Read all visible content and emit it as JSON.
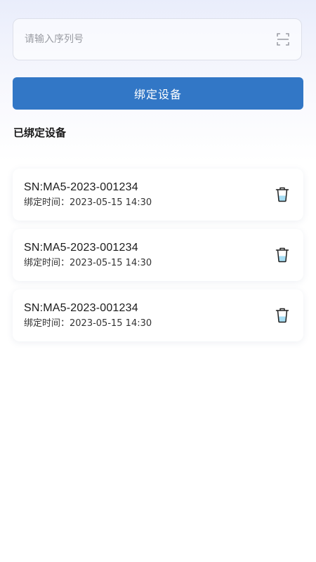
{
  "search": {
    "placeholder": "请输入序列号",
    "value": "",
    "scan_icon": "scan-icon"
  },
  "bind_button": {
    "label": "绑定设备",
    "color": "#3277c6"
  },
  "section": {
    "title": "已绑定设备"
  },
  "devices": [
    {
      "sn": "SN:MA5-2023-001234",
      "bind_time": "绑定时间：2023-05-15 14:30",
      "icon": "trash-icon"
    },
    {
      "sn": "SN:MA5-2023-001234",
      "bind_time": "绑定时间：2023-05-15 14:30",
      "icon": "trash-icon"
    },
    {
      "sn": "SN:MA5-2023-001234",
      "bind_time": "绑定时间：2023-05-15 14:30",
      "icon": "trash-icon"
    }
  ],
  "colors": {
    "accent": "#3277c6",
    "trash_fill": "#a7ddf3"
  }
}
